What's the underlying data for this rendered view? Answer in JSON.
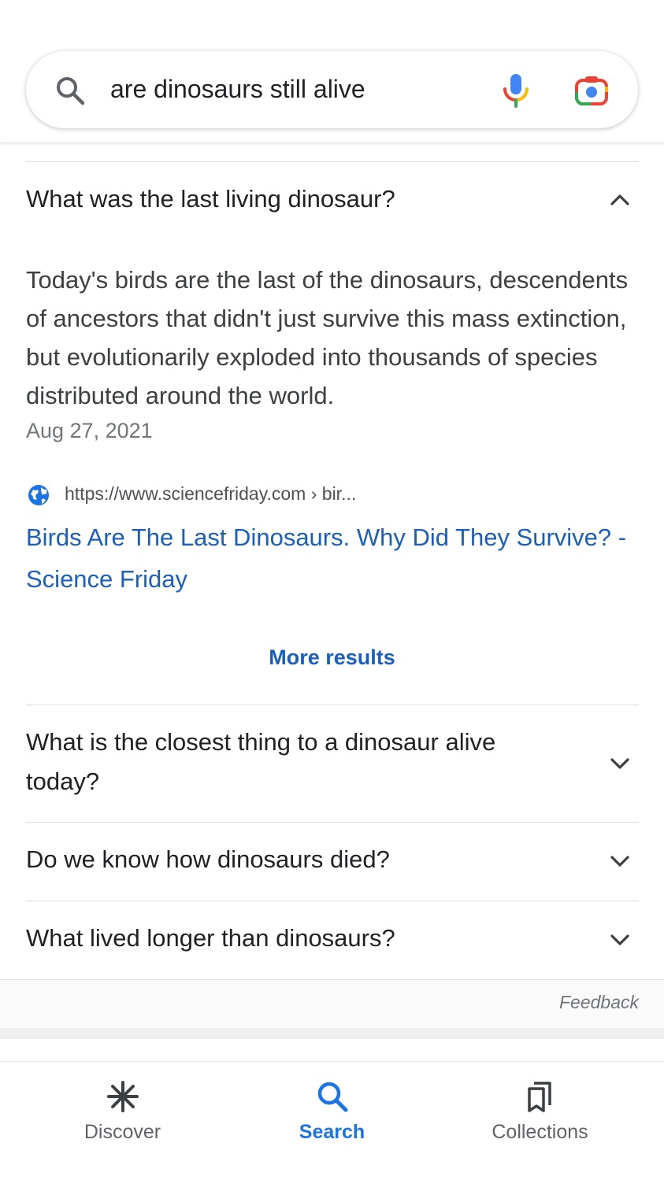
{
  "search": {
    "query": "are dinosaurs still alive"
  },
  "faq": {
    "expanded": {
      "question": "What was the last living dinosaur?",
      "answer": "Today's birds are the last of the dinosaurs, descendents of ancestors that didn't just survive this mass extinction, but evolutionarily exploded into thousands of species distributed around the world.",
      "date": "Aug 27, 2021",
      "source_url": "https://www.sciencefriday.com › bir...",
      "result_title": "Birds Are The Last Dinosaurs. Why Did They Survive? - Science Friday",
      "more_results": "More results"
    },
    "collapsed": [
      {
        "question": "What is the closest thing to a dinosaur alive today?"
      },
      {
        "question": "Do we know how dinosaurs died?"
      },
      {
        "question": "What lived longer than dinosaurs?"
      }
    ],
    "feedback": "Feedback"
  },
  "bottom_nav": {
    "items": [
      {
        "label": "Discover",
        "icon": "asterisk-icon",
        "active": false
      },
      {
        "label": "Search",
        "icon": "search-icon",
        "active": true
      },
      {
        "label": "Collections",
        "icon": "bookmarks-icon",
        "active": false
      }
    ]
  },
  "colors": {
    "link": "#1a5fbf",
    "active_nav": "#1a73e8",
    "mic_blue": "#4285f4",
    "mic_red": "#ea4335",
    "mic_yellow": "#fbbc04",
    "mic_green": "#34a853"
  }
}
